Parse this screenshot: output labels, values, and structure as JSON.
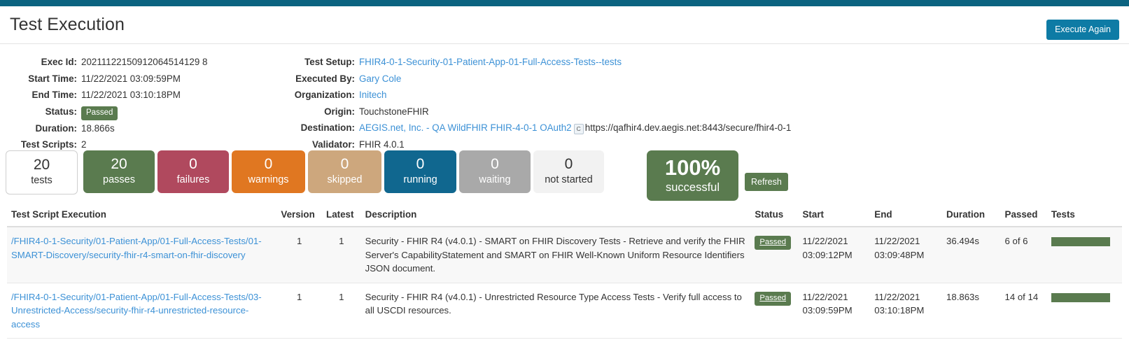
{
  "header": {
    "title": "Test Execution",
    "execute_again_label": "Execute Again"
  },
  "details_left": [
    {
      "label": "Exec Id:",
      "value": "20211122150912064514129 8"
    },
    {
      "label": "Start Time:",
      "value": "11/22/2021 03:09:59PM"
    },
    {
      "label": "End Time:",
      "value": "11/22/2021 03:10:18PM"
    },
    {
      "label": "Status:",
      "value": "Passed"
    },
    {
      "label": "Duration:",
      "value": "18.866s"
    },
    {
      "label": "Test Scripts:",
      "value": "2"
    }
  ],
  "details_left_fixed": {
    "exec_id_label": "Exec Id:",
    "exec_id": "20211122150912064514129 8",
    "start_time_label": "Start Time:",
    "start_time": "11/22/2021 03:09:59PM",
    "end_time_label": "End Time:",
    "end_time": "11/22/2021 03:10:18PM",
    "status_label": "Status:",
    "status": "Passed",
    "duration_label": "Duration:",
    "duration": "18.866s",
    "test_scripts_label": "Test Scripts:",
    "test_scripts": "2"
  },
  "details_right": {
    "test_setup_label": "Test Setup:",
    "test_setup": "FHIR4-0-1-Security-01-Patient-App-01-Full-Access-Tests--tests",
    "executed_by_label": "Executed By:",
    "executed_by": "Gary Cole",
    "organization_label": "Organization:",
    "organization": "Initech",
    "origin_label": "Origin:",
    "origin": "TouchstoneFHIR",
    "destination_label": "Destination:",
    "destination": "AEGIS.net, Inc. - QA WildFHIR FHIR-4-0-1 OAuth2",
    "destination_cert_badge": "C",
    "destination_url": "https://qafhir4.dev.aegis.net:8443/secure/fhir4-0-1",
    "validator_label": "Validator:",
    "validator": "FHIR 4.0.1"
  },
  "tiles": [
    {
      "key": "tests",
      "count": "20",
      "label": "tests",
      "color": "#ffffff"
    },
    {
      "key": "passes",
      "count": "20",
      "label": "passes",
      "color": "#5a7b4f"
    },
    {
      "key": "failures",
      "count": "0",
      "label": "failures",
      "color": "#b0495e"
    },
    {
      "key": "warnings",
      "count": "0",
      "label": "warnings",
      "color": "#e07721"
    },
    {
      "key": "skipped",
      "count": "0",
      "label": "skipped",
      "color": "#cda77d"
    },
    {
      "key": "running",
      "count": "0",
      "label": "running",
      "color": "#10678f"
    },
    {
      "key": "waiting",
      "count": "0",
      "label": "waiting",
      "color": "#a9a9a9"
    },
    {
      "key": "not-started",
      "count": "0",
      "label": "not started",
      "color": "#f2f2f2"
    }
  ],
  "success": {
    "percent": "100%",
    "label": "successful",
    "refresh_label": "Refresh"
  },
  "table": {
    "columns": [
      "Test Script Execution",
      "Version",
      "Latest",
      "Description",
      "Status",
      "Start",
      "End",
      "Duration",
      "Passed",
      "Tests"
    ],
    "rows": [
      {
        "script": "/FHIR4-0-1-Security/01-Patient-App/01-Full-Access-Tests/01-SMART-Discovery/security-fhir-r4-smart-on-fhir-discovery",
        "version": "1",
        "latest": "1",
        "description": "Security - FHIR R4 (v4.0.1) - SMART on FHIR Discovery Tests - Retrieve and verify the FHIR Server's CapabilityStatement and SMART on FHIR Well-Known Uniform Resource Identifiers JSON document.",
        "status": "Passed",
        "start_date": "11/22/2021",
        "start_time": "03:09:12PM",
        "end_date": "11/22/2021",
        "end_time": "03:09:48PM",
        "duration": "36.494s",
        "passed": "6 of 6",
        "tests_bar_percent": 100
      },
      {
        "script": "/FHIR4-0-1-Security/01-Patient-App/01-Full-Access-Tests/03-Unrestricted-Access/security-fhir-r4-unrestricted-resource-access",
        "version": "1",
        "latest": "1",
        "description": "Security - FHIR R4 (v4.0.1) - Unrestricted Resource Type Access Tests - Verify full access to all USCDI resources.",
        "status": "Passed",
        "start_date": "11/22/2021",
        "start_time": "03:09:59PM",
        "end_date": "11/22/2021",
        "end_time": "03:10:18PM",
        "duration": "18.863s",
        "passed": "14 of 14",
        "tests_bar_percent": 100
      }
    ]
  }
}
